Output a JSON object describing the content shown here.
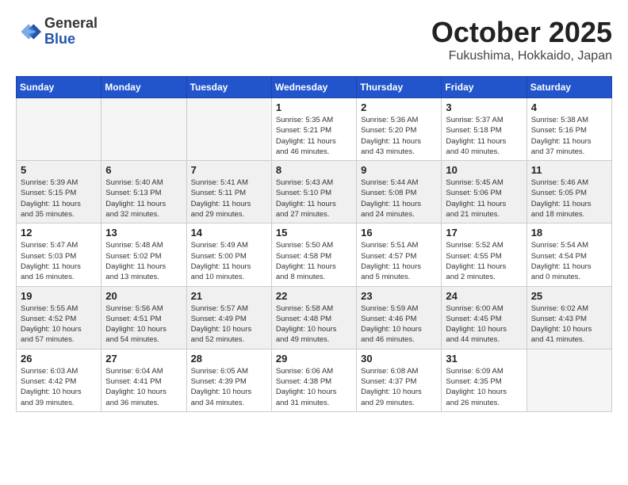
{
  "header": {
    "logo_general": "General",
    "logo_blue": "Blue",
    "month_title": "October 2025",
    "location": "Fukushima, Hokkaido, Japan"
  },
  "days_of_week": [
    "Sunday",
    "Monday",
    "Tuesday",
    "Wednesday",
    "Thursday",
    "Friday",
    "Saturday"
  ],
  "weeks": [
    {
      "shaded": false,
      "days": [
        {
          "number": "",
          "info": ""
        },
        {
          "number": "",
          "info": ""
        },
        {
          "number": "",
          "info": ""
        },
        {
          "number": "1",
          "info": "Sunrise: 5:35 AM\nSunset: 5:21 PM\nDaylight: 11 hours\nand 46 minutes."
        },
        {
          "number": "2",
          "info": "Sunrise: 5:36 AM\nSunset: 5:20 PM\nDaylight: 11 hours\nand 43 minutes."
        },
        {
          "number": "3",
          "info": "Sunrise: 5:37 AM\nSunset: 5:18 PM\nDaylight: 11 hours\nand 40 minutes."
        },
        {
          "number": "4",
          "info": "Sunrise: 5:38 AM\nSunset: 5:16 PM\nDaylight: 11 hours\nand 37 minutes."
        }
      ]
    },
    {
      "shaded": true,
      "days": [
        {
          "number": "5",
          "info": "Sunrise: 5:39 AM\nSunset: 5:15 PM\nDaylight: 11 hours\nand 35 minutes."
        },
        {
          "number": "6",
          "info": "Sunrise: 5:40 AM\nSunset: 5:13 PM\nDaylight: 11 hours\nand 32 minutes."
        },
        {
          "number": "7",
          "info": "Sunrise: 5:41 AM\nSunset: 5:11 PM\nDaylight: 11 hours\nand 29 minutes."
        },
        {
          "number": "8",
          "info": "Sunrise: 5:43 AM\nSunset: 5:10 PM\nDaylight: 11 hours\nand 27 minutes."
        },
        {
          "number": "9",
          "info": "Sunrise: 5:44 AM\nSunset: 5:08 PM\nDaylight: 11 hours\nand 24 minutes."
        },
        {
          "number": "10",
          "info": "Sunrise: 5:45 AM\nSunset: 5:06 PM\nDaylight: 11 hours\nand 21 minutes."
        },
        {
          "number": "11",
          "info": "Sunrise: 5:46 AM\nSunset: 5:05 PM\nDaylight: 11 hours\nand 18 minutes."
        }
      ]
    },
    {
      "shaded": false,
      "days": [
        {
          "number": "12",
          "info": "Sunrise: 5:47 AM\nSunset: 5:03 PM\nDaylight: 11 hours\nand 16 minutes."
        },
        {
          "number": "13",
          "info": "Sunrise: 5:48 AM\nSunset: 5:02 PM\nDaylight: 11 hours\nand 13 minutes."
        },
        {
          "number": "14",
          "info": "Sunrise: 5:49 AM\nSunset: 5:00 PM\nDaylight: 11 hours\nand 10 minutes."
        },
        {
          "number": "15",
          "info": "Sunrise: 5:50 AM\nSunset: 4:58 PM\nDaylight: 11 hours\nand 8 minutes."
        },
        {
          "number": "16",
          "info": "Sunrise: 5:51 AM\nSunset: 4:57 PM\nDaylight: 11 hours\nand 5 minutes."
        },
        {
          "number": "17",
          "info": "Sunrise: 5:52 AM\nSunset: 4:55 PM\nDaylight: 11 hours\nand 2 minutes."
        },
        {
          "number": "18",
          "info": "Sunrise: 5:54 AM\nSunset: 4:54 PM\nDaylight: 11 hours\nand 0 minutes."
        }
      ]
    },
    {
      "shaded": true,
      "days": [
        {
          "number": "19",
          "info": "Sunrise: 5:55 AM\nSunset: 4:52 PM\nDaylight: 10 hours\nand 57 minutes."
        },
        {
          "number": "20",
          "info": "Sunrise: 5:56 AM\nSunset: 4:51 PM\nDaylight: 10 hours\nand 54 minutes."
        },
        {
          "number": "21",
          "info": "Sunrise: 5:57 AM\nSunset: 4:49 PM\nDaylight: 10 hours\nand 52 minutes."
        },
        {
          "number": "22",
          "info": "Sunrise: 5:58 AM\nSunset: 4:48 PM\nDaylight: 10 hours\nand 49 minutes."
        },
        {
          "number": "23",
          "info": "Sunrise: 5:59 AM\nSunset: 4:46 PM\nDaylight: 10 hours\nand 46 minutes."
        },
        {
          "number": "24",
          "info": "Sunrise: 6:00 AM\nSunset: 4:45 PM\nDaylight: 10 hours\nand 44 minutes."
        },
        {
          "number": "25",
          "info": "Sunrise: 6:02 AM\nSunset: 4:43 PM\nDaylight: 10 hours\nand 41 minutes."
        }
      ]
    },
    {
      "shaded": false,
      "days": [
        {
          "number": "26",
          "info": "Sunrise: 6:03 AM\nSunset: 4:42 PM\nDaylight: 10 hours\nand 39 minutes."
        },
        {
          "number": "27",
          "info": "Sunrise: 6:04 AM\nSunset: 4:41 PM\nDaylight: 10 hours\nand 36 minutes."
        },
        {
          "number": "28",
          "info": "Sunrise: 6:05 AM\nSunset: 4:39 PM\nDaylight: 10 hours\nand 34 minutes."
        },
        {
          "number": "29",
          "info": "Sunrise: 6:06 AM\nSunset: 4:38 PM\nDaylight: 10 hours\nand 31 minutes."
        },
        {
          "number": "30",
          "info": "Sunrise: 6:08 AM\nSunset: 4:37 PM\nDaylight: 10 hours\nand 29 minutes."
        },
        {
          "number": "31",
          "info": "Sunrise: 6:09 AM\nSunset: 4:35 PM\nDaylight: 10 hours\nand 26 minutes."
        },
        {
          "number": "",
          "info": ""
        }
      ]
    }
  ]
}
